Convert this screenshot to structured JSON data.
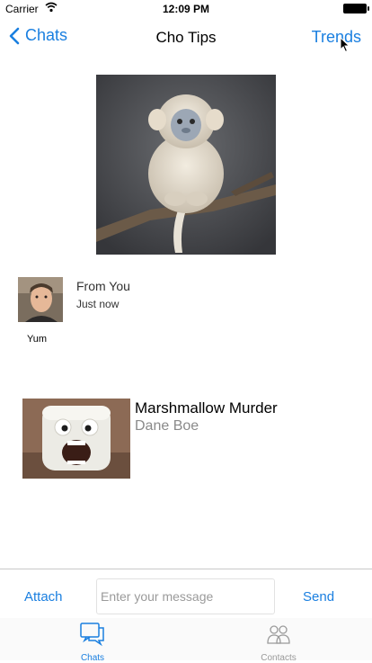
{
  "status_bar": {
    "carrier": "Carrier",
    "time": "12:09 PM"
  },
  "nav": {
    "back_label": "Chats",
    "title": "Cho Tips",
    "right_label": "Trends"
  },
  "message": {
    "sender": "From You",
    "timestamp": "Just now",
    "caption": "Yum"
  },
  "card": {
    "title": "Marshmallow Murder",
    "subtitle": "Dane Boe"
  },
  "composer": {
    "attach_label": "Attach",
    "input_placeholder": "Enter your message",
    "input_value": "",
    "send_label": "Send"
  },
  "tabs": [
    {
      "label": "Chats",
      "icon": "chat-bubbles-icon",
      "selected": true
    },
    {
      "label": "Contacts",
      "icon": "people-icon",
      "selected": false
    }
  ],
  "colors": {
    "accent": "#1a7fe0",
    "inactive": "#9a9a9a"
  }
}
